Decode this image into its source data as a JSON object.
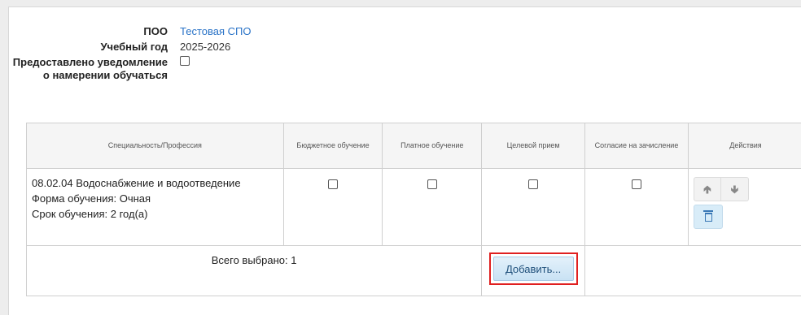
{
  "info": {
    "poo_label": "ПОО",
    "poo_value": "Тестовая СПО",
    "year_label": "Учебный год",
    "year_value": "2025-2026",
    "notice_label": "Предоставлено уведомление о намерении обучаться",
    "notice_checked": false
  },
  "table": {
    "headers": {
      "specialty": "Специальность/Профессия",
      "budget": "Бюджетное обучение",
      "paid": "Платное обучение",
      "target": "Целевой прием",
      "consent": "Согласие на зачисление",
      "actions": "Действия"
    },
    "rows": [
      {
        "specialty_name": "08.02.04 Водоснабжение и водоотведение",
        "form": "Форма обучения: Очная",
        "duration": "Срок обучения: 2 год(а)",
        "budget": false,
        "paid": false,
        "target": false,
        "consent": false
      }
    ],
    "icons": {
      "up": "arrow-up-icon",
      "down": "arrow-down-icon",
      "delete": "trash-icon"
    },
    "footer": {
      "total": "Всего выбрано: 1",
      "add_label": "Добавить..."
    }
  },
  "colors": {
    "link": "#2a73c7",
    "highlight": "#e02020",
    "button_bg": "#d8ecf8"
  }
}
